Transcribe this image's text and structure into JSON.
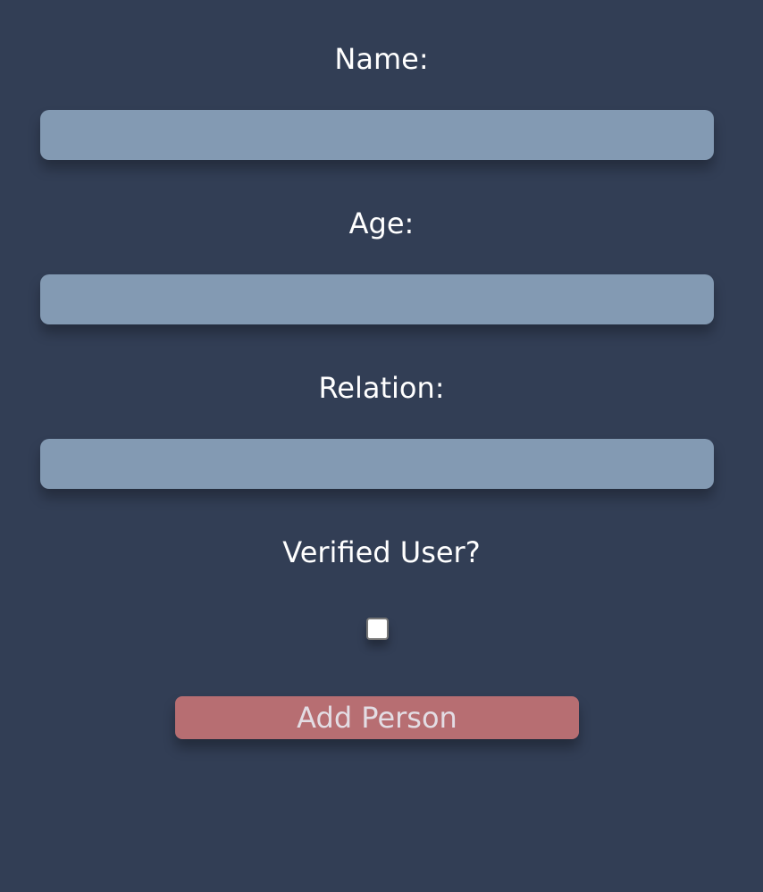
{
  "form": {
    "fields": [
      {
        "label": "Name:",
        "value": ""
      },
      {
        "label": "Age:",
        "value": ""
      },
      {
        "label": "Relation:",
        "value": ""
      }
    ],
    "verified": {
      "label": "Verified User?",
      "checked": false
    },
    "submit_label": "Add Person"
  },
  "colors": {
    "background": "#323e55",
    "input_fill": "#839ab3",
    "button_fill": "#b76e72",
    "button_text": "#e3dde4",
    "label_text": "#ffffff"
  }
}
